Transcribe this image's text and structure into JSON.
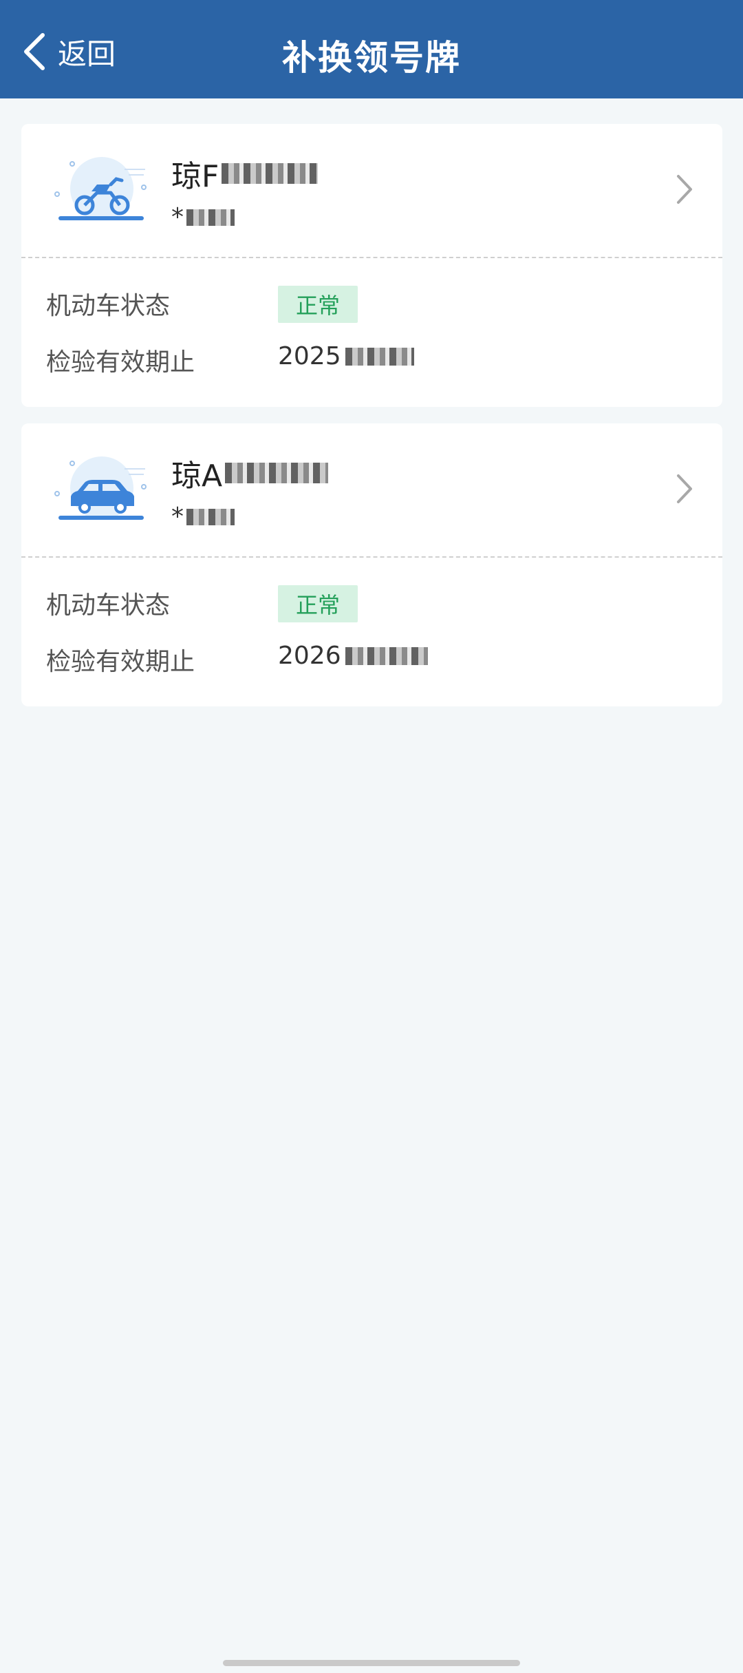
{
  "header": {
    "back_label": "返回",
    "title": "补换领号牌"
  },
  "vehicles": [
    {
      "plate": "琼F",
      "owner": "*",
      "status_label": "机动车状态",
      "status_value": "正常",
      "expiry_label": "检验有效期止",
      "expiry_value": "2025",
      "icon": "motorcycle-icon"
    },
    {
      "plate": "琼A",
      "owner": "*",
      "status_label": "机动车状态",
      "status_value": "正常",
      "expiry_label": "检验有效期止",
      "expiry_value": "2026",
      "icon": "car-icon"
    }
  ],
  "colors": {
    "header_bg": "#2b64a6",
    "page_bg": "#f3f7f9",
    "status_green": "#24a05a",
    "badge_bg": "#d6f2e2",
    "icon_blue": "#3d84d9"
  }
}
